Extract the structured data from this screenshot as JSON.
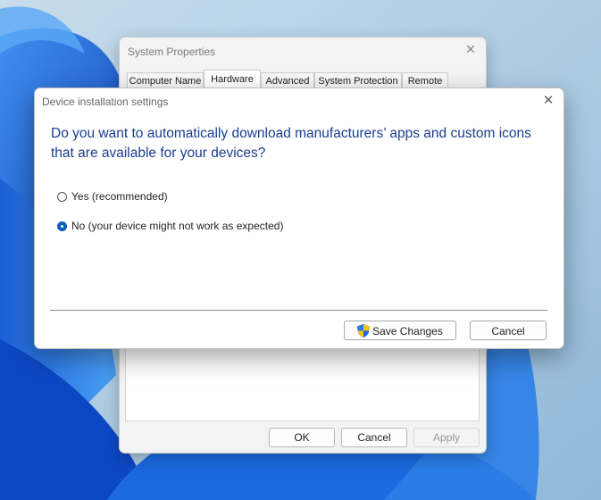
{
  "background": {
    "accent": "#1a63d8",
    "icon": "windows-bloom-wallpaper"
  },
  "system_properties": {
    "title": "System Properties",
    "close_icon": "close-icon",
    "tabs": [
      {
        "label": "Computer Name"
      },
      {
        "label": "Hardware"
      },
      {
        "label": "Advanced"
      },
      {
        "label": "System Protection"
      },
      {
        "label": "Remote"
      }
    ],
    "selected_tab": "Hardware",
    "buttons": {
      "ok": "OK",
      "cancel": "Cancel",
      "apply": "Apply"
    }
  },
  "dialog": {
    "title": "Device installation settings",
    "close_icon": "close-icon",
    "question": "Do you want to automatically download manufacturers’ apps and custom icons that are available for your devices?",
    "options": [
      {
        "label": "Yes (recommended)",
        "checked": false
      },
      {
        "label": "No (your device might not work as expected)",
        "checked": true
      }
    ],
    "buttons": {
      "save": "Save Changes",
      "cancel": "Cancel"
    },
    "colors": {
      "question_text": "#1a3d8f",
      "radio_checked": "#0a5fb8"
    }
  }
}
